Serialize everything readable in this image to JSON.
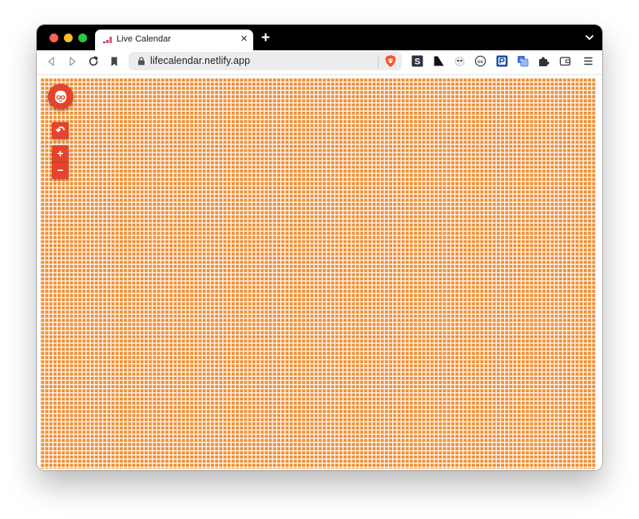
{
  "browser": {
    "tab": {
      "title": "Live Calendar",
      "favicon": "life-calendar-favicon",
      "close_glyph": "×"
    },
    "new_tab_glyph": "+",
    "url": "lifecalendar.netlify.app",
    "toolbar_icons": [
      "back-icon",
      "forward-icon",
      "reload-icon",
      "bookmark-icon",
      "lock-icon",
      "brave-shield-icon",
      "extensions-puzzle-icon",
      "wallet-icon",
      "menu-icon"
    ],
    "extension_icons": [
      "s-extension-icon",
      "notion-extension-icon",
      "owl-extension-icon",
      "cc-extension-icon",
      "pocket-style-extension-icon",
      "translate-extension-icon"
    ]
  },
  "app": {
    "controls": {
      "avatar_icon": "face-avatar-icon",
      "undo_glyph": "↶",
      "zoom_in_glyph": "+",
      "zoom_out_glyph": "−"
    }
  },
  "colors": {
    "grid_cell": "#ee8f35",
    "accent_button": "#e4442b",
    "chrome_bar": "#000000"
  }
}
